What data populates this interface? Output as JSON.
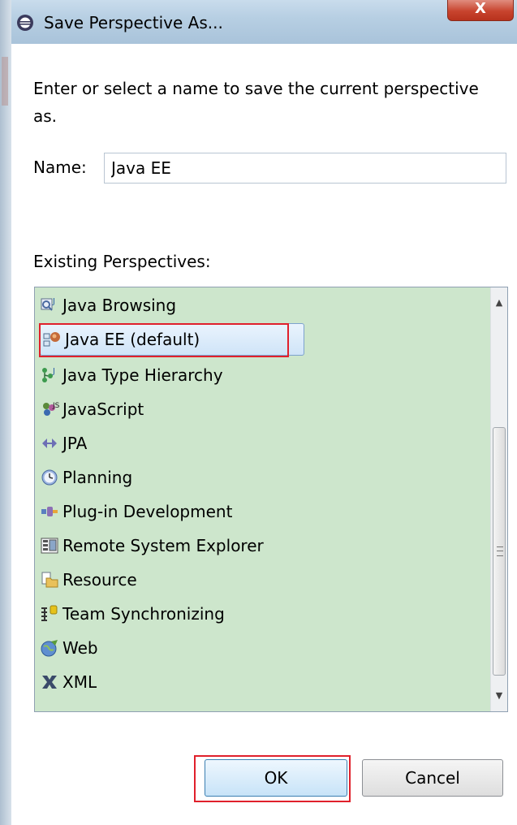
{
  "window": {
    "title": "Save Perspective As...",
    "close_label": "X"
  },
  "dialog": {
    "instruction": "Enter or select a name to save the current perspective as.",
    "name_label": "Name:",
    "name_value": "Java EE",
    "existing_label": "Existing Perspectives:"
  },
  "perspectives": [
    {
      "label": "Java Browsing",
      "icon": "java-browsing-icon"
    },
    {
      "label": "Java EE (default)",
      "icon": "java-ee-icon",
      "selected": true
    },
    {
      "label": "Java Type Hierarchy",
      "icon": "java-type-hierarchy-icon"
    },
    {
      "label": "JavaScript",
      "icon": "javascript-icon"
    },
    {
      "label": "JPA",
      "icon": "jpa-icon"
    },
    {
      "label": "Planning",
      "icon": "planning-icon"
    },
    {
      "label": "Plug-in Development",
      "icon": "plugin-development-icon"
    },
    {
      "label": "Remote System Explorer",
      "icon": "remote-system-explorer-icon"
    },
    {
      "label": "Resource",
      "icon": "resource-icon"
    },
    {
      "label": "Team Synchronizing",
      "icon": "team-synchronizing-icon"
    },
    {
      "label": "Web",
      "icon": "web-icon"
    },
    {
      "label": "XML",
      "icon": "xml-icon"
    }
  ],
  "buttons": {
    "ok": "OK",
    "cancel": "Cancel"
  },
  "colors": {
    "list_background": "#cde6cc",
    "highlight_box": "#e0202b",
    "selection": "#cfe4f8"
  }
}
